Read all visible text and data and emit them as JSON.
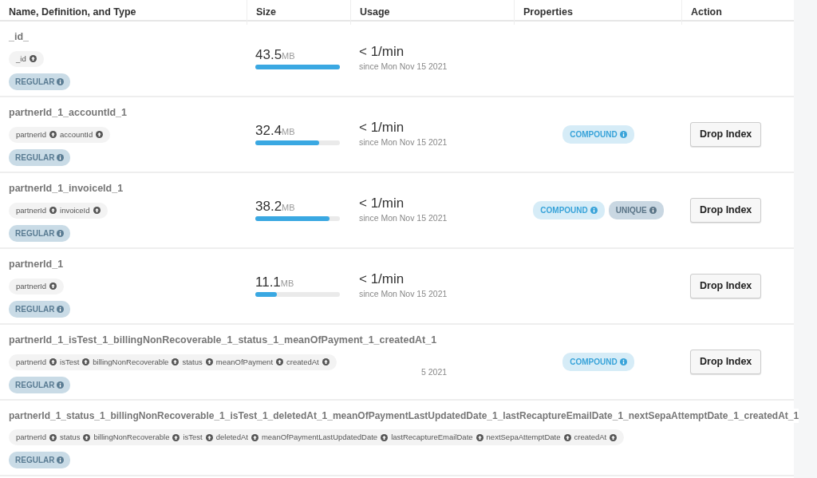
{
  "columns": [
    "Name, Definition, and Type",
    "Size",
    "Usage",
    "Properties",
    "Action"
  ],
  "indexes": [
    {
      "name": "_id_",
      "fields": [
        "_id"
      ],
      "type": "REGULAR",
      "size": {
        "value": "43.5",
        "unit": "MB",
        "level": 1.0
      },
      "usage": {
        "rate": "< 1/min",
        "since": "since Mon Nov 15 2021"
      }
    },
    {
      "name": "partnerId_1_accountId_1",
      "fields": [
        "partnerId",
        "accountId"
      ],
      "type": "REGULAR",
      "size": {
        "value": "32.4",
        "unit": "MB",
        "level": 0.75
      },
      "usage": {
        "rate": "< 1/min",
        "since": "since Mon Nov 15 2021"
      },
      "properties": [
        {
          "label": "COMPOUND",
          "kind": "compound"
        }
      ],
      "action": "Drop Index"
    },
    {
      "name": "partnerId_1_invoiceId_1",
      "fields": [
        "partnerId",
        "invoiceId"
      ],
      "type": "REGULAR",
      "size": {
        "value": "38.2",
        "unit": "MB",
        "level": 0.88
      },
      "usage": {
        "rate": "< 1/min",
        "since": "since Mon Nov 15 2021"
      },
      "properties": [
        {
          "label": "COMPOUND",
          "kind": "compound"
        },
        {
          "label": "UNIQUE",
          "kind": "unique"
        }
      ],
      "action": "Drop Index"
    },
    {
      "name": "partnerId_1",
      "fields": [
        "partnerId"
      ],
      "type": "REGULAR",
      "size": {
        "value": "11.1",
        "unit": "MB",
        "level": 0.25
      },
      "usage": {
        "rate": "< 1/min",
        "since": "since Mon Nov 15 2021"
      },
      "action": "Drop Index"
    },
    {
      "name": "partnerId_1_isTest_1_billingNonRecoverable_1_status_1_meanOfPayment_1_createdAt_1",
      "fields": [
        "partnerId",
        "isTest",
        "billingNonRecoverable",
        "status",
        "meanOfPayment",
        "createdAt"
      ],
      "type": "REGULAR",
      "usage": {
        "since": "5 2021"
      },
      "properties": [
        {
          "label": "COMPOUND",
          "kind": "compound"
        }
      ],
      "action": "Drop Index"
    },
    {
      "name": "partnerId_1_status_1_billingNonRecoverable_1_isTest_1_deletedAt_1_meanOfPaymentLastUpdatedDate_1_lastRecaptureEmailDate_1_nextSepaAttemptDate_1_createdAt_1",
      "fields": [
        "partnerId",
        "status",
        "billingNonRecoverable",
        "isTest",
        "deletedAt",
        "meanOfPaymentLastUpdatedDate",
        "lastRecaptureEmailDate",
        "nextSepaAttemptDate",
        "createdAt"
      ],
      "type": "REGULAR"
    }
  ]
}
